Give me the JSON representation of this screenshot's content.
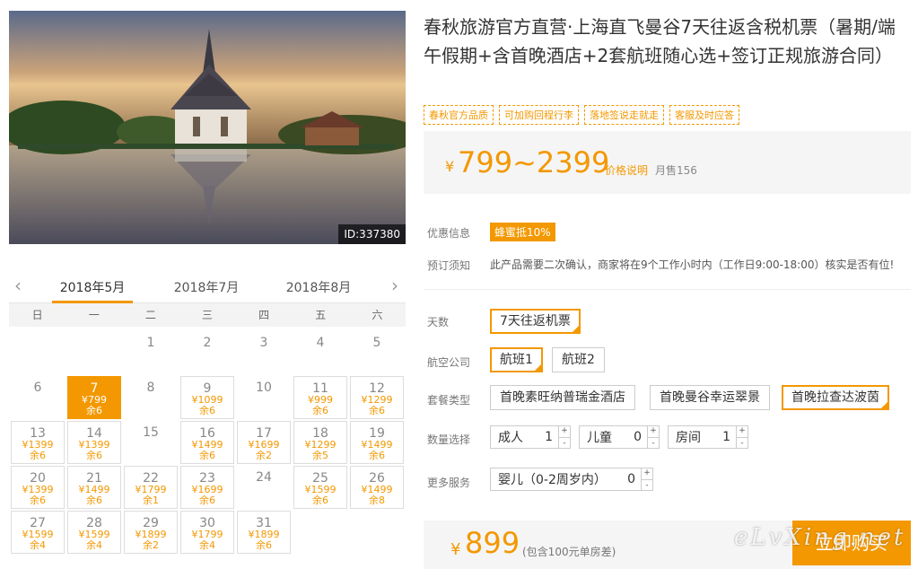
{
  "hero": {
    "product_id": "ID:337380"
  },
  "calendar": {
    "months": [
      "2018年5月",
      "2018年7月",
      "2018年8月"
    ],
    "active_month_index": 0,
    "weekdays": [
      "日",
      "一",
      "二",
      "三",
      "四",
      "五",
      "六"
    ],
    "cells": [
      {
        "day": "",
        "price": "",
        "left": ""
      },
      {
        "day": "",
        "price": "",
        "left": ""
      },
      {
        "day": "1",
        "price": "",
        "left": ""
      },
      {
        "day": "2",
        "price": "",
        "left": ""
      },
      {
        "day": "3",
        "price": "",
        "left": ""
      },
      {
        "day": "4",
        "price": "",
        "left": ""
      },
      {
        "day": "5",
        "price": "",
        "left": ""
      },
      {
        "day": "6",
        "price": "",
        "left": ""
      },
      {
        "day": "7",
        "price": "¥799",
        "left": "余6",
        "selected": true
      },
      {
        "day": "8",
        "price": "",
        "left": ""
      },
      {
        "day": "9",
        "price": "¥1099",
        "left": "余6"
      },
      {
        "day": "10",
        "price": "",
        "left": ""
      },
      {
        "day": "11",
        "price": "¥999",
        "left": "余6"
      },
      {
        "day": "12",
        "price": "¥1299",
        "left": "余6"
      },
      {
        "day": "13",
        "price": "¥1399",
        "left": "余6"
      },
      {
        "day": "14",
        "price": "¥1399",
        "left": "余6"
      },
      {
        "day": "15",
        "price": "",
        "left": ""
      },
      {
        "day": "16",
        "price": "¥1499",
        "left": "余6"
      },
      {
        "day": "17",
        "price": "¥1699",
        "left": "余2"
      },
      {
        "day": "18",
        "price": "¥1299",
        "left": "余5"
      },
      {
        "day": "19",
        "price": "¥1499",
        "left": "余6"
      },
      {
        "day": "20",
        "price": "¥1399",
        "left": "余6"
      },
      {
        "day": "21",
        "price": "¥1499",
        "left": "余6"
      },
      {
        "day": "22",
        "price": "¥1799",
        "left": "余1"
      },
      {
        "day": "23",
        "price": "¥1699",
        "left": "余6"
      },
      {
        "day": "24",
        "price": "",
        "left": ""
      },
      {
        "day": "25",
        "price": "¥1599",
        "left": "余6"
      },
      {
        "day": "26",
        "price": "¥1499",
        "left": "余8"
      },
      {
        "day": "27",
        "price": "¥1599",
        "left": "余4"
      },
      {
        "day": "28",
        "price": "¥1599",
        "left": "余4"
      },
      {
        "day": "29",
        "price": "¥1899",
        "left": "余2"
      },
      {
        "day": "30",
        "price": "¥1799",
        "left": "余4"
      },
      {
        "day": "31",
        "price": "¥1899",
        "left": "余6"
      }
    ]
  },
  "product": {
    "title": "春秋旅游官方直营·上海直飞曼谷7天往返含税机票（暑期/端午假期+含首晚酒店+2套航班随心选+签订正规旅游合同）",
    "tags": [
      "春秋官方品质",
      "可加购回程行李",
      "落地签说走就走",
      "客服及时应答"
    ],
    "price_currency": "¥",
    "price_range": "799~2399",
    "price_explain": "价格说明",
    "monthly_sales": "月售156"
  },
  "info": {
    "promo_label": "优惠信息",
    "promo_badge": "蜂蜜抵10%",
    "notice_label": "预订须知",
    "notice_text": "此产品需要二次确认，商家将在9个工作小时内（工作日9:00-18:00）核实是否有位!"
  },
  "options": {
    "days_label": "天数",
    "days": [
      "7天往返机票"
    ],
    "airline_label": "航空公司",
    "airlines": [
      "航班1",
      "航班2"
    ],
    "package_label": "套餐类型",
    "packages": [
      "首晚素旺纳普瑞金酒店",
      "首晚曼谷幸运翠景",
      "首晚拉查达波茵"
    ],
    "quantity_label": "数量选择",
    "adult_label": "成人",
    "adult_value": "1",
    "child_label": "儿童",
    "child_value": "0",
    "room_label": "房间",
    "room_value": "1",
    "more_label": "更多服务",
    "infant_label": "婴儿（0-2周岁内）",
    "infant_value": "0",
    "plus": "+",
    "minus": "-"
  },
  "purchase": {
    "currency": "¥",
    "total": "899",
    "note": "(包含100元单房差)",
    "buy_label": "立即购买"
  },
  "watermark": "eLvXing.net",
  "colors": {
    "accent": "#f39800"
  }
}
